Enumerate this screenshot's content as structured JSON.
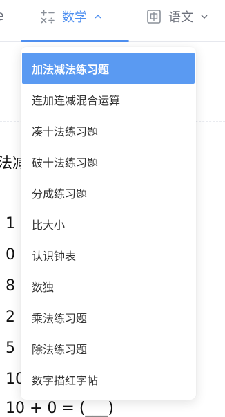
{
  "nav": {
    "cut_label": "e",
    "tabs": [
      {
        "label": "数学",
        "icon": "math-operators-icon",
        "active": true
      },
      {
        "label": "语文",
        "icon": "character-grid-icon",
        "active": false
      }
    ]
  },
  "background": {
    "title_fragment": "法减",
    "lines": [
      {
        "text": "1 -"
      },
      {
        "text": "0 -"
      },
      {
        "text": "8 -"
      },
      {
        "text": "2 -"
      },
      {
        "text": "5 -"
      },
      {
        "text": "10"
      },
      {
        "text": "10 + 0 = (___)"
      }
    ]
  },
  "dropdown": {
    "items": [
      {
        "label": "加法减法练习题",
        "active": true
      },
      {
        "label": "连加连减混合运算",
        "active": false
      },
      {
        "label": "凑十法练习题",
        "active": false
      },
      {
        "label": "破十法练习题",
        "active": false
      },
      {
        "label": "分成练习题",
        "active": false
      },
      {
        "label": "比大小",
        "active": false
      },
      {
        "label": "认识钟表",
        "active": false
      },
      {
        "label": "数独",
        "active": false
      },
      {
        "label": "乘法练习题",
        "active": false
      },
      {
        "label": "除法练习题",
        "active": false
      },
      {
        "label": "数字描红字帖",
        "active": false
      }
    ]
  },
  "colors": {
    "accent": "#4e8ff0",
    "active_bg": "#5a9af2"
  }
}
